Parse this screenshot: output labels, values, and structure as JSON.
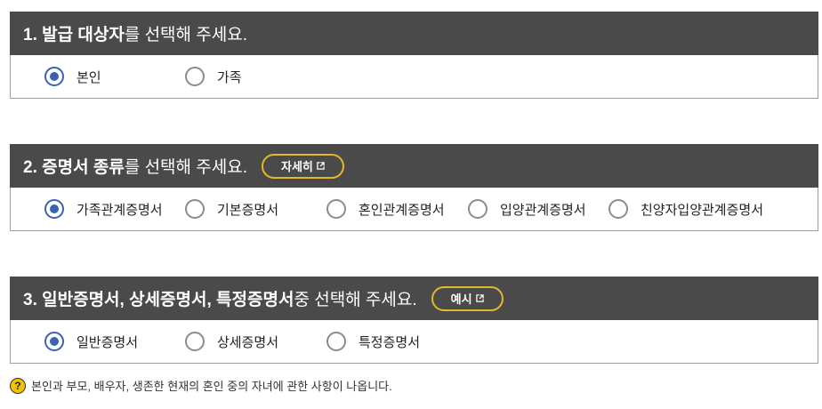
{
  "section1": {
    "header_bold": "1. 발급 대상자",
    "header_rest": "를 선택해 주세요.",
    "options": [
      {
        "label": "본인",
        "checked": true
      },
      {
        "label": "가족",
        "checked": false
      }
    ]
  },
  "section2": {
    "header_bold": "2. 증명서 종류",
    "header_rest": "를 선택해 주세요.",
    "button_label": "자세히",
    "options": [
      {
        "label": "가족관계증명서",
        "checked": true
      },
      {
        "label": "기본증명서",
        "checked": false
      },
      {
        "label": "혼인관계증명서",
        "checked": false
      },
      {
        "label": "입양관계증명서",
        "checked": false
      },
      {
        "label": "친양자입양관계증명서",
        "checked": false
      }
    ]
  },
  "section3": {
    "header_bold": "3. 일반증명서, 상세증명서, 특정증명서",
    "header_rest": " 중 선택해 주세요.",
    "button_label": "예시",
    "options": [
      {
        "label": "일반증명서",
        "checked": true
      },
      {
        "label": "상세증명서",
        "checked": false
      },
      {
        "label": "특정증명서",
        "checked": false
      }
    ]
  },
  "note": {
    "icon": "?",
    "text": "본인과 부모, 배우자, 생존한 현재의 혼인 중의 자녀에 관한 사항이 나옵니다."
  },
  "colors": {
    "header_bg": "#4a4a4a",
    "accent_blue": "#3a63b5",
    "button_border": "#e4b82a",
    "help_icon": "#f2c200"
  }
}
